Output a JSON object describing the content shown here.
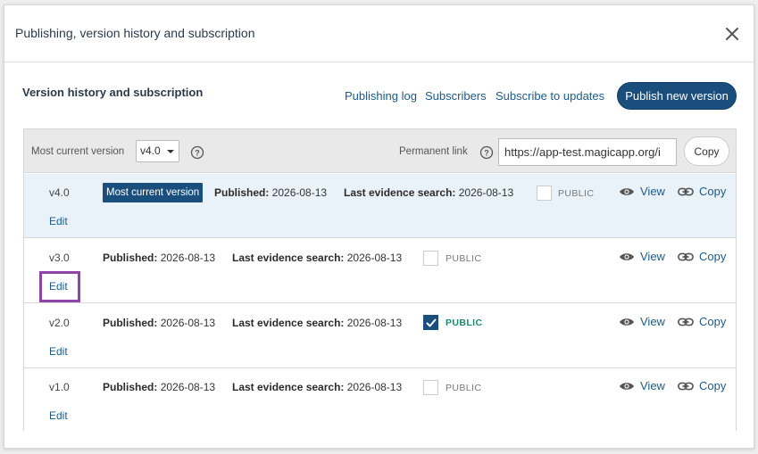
{
  "dialog": {
    "title": "Publishing, version history and subscription"
  },
  "section": {
    "title": "Version history and subscription",
    "links": {
      "publishing_log": "Publishing log",
      "subscribers": "Subscribers",
      "subscribe": "Subscribe to updates"
    },
    "publish_button": "Publish new version"
  },
  "toolbar": {
    "current_version_label": "Most current version",
    "selected_version": "v4.0",
    "permanent_link_label": "Permanent link",
    "permanent_link_value": "https://app-test.magicapp.org/i",
    "copy_label": "Copy"
  },
  "labels": {
    "published": "Published:",
    "last_search": "Last evidence search:",
    "public": "PUBLIC",
    "view": "View",
    "copy": "Copy",
    "edit": "Edit",
    "most_current": "Most current version"
  },
  "versions": [
    {
      "version": "v4.0",
      "published": "2026-08-13",
      "last_search": "2026-08-13",
      "public": false,
      "current": true
    },
    {
      "version": "v3.0",
      "published": "2026-08-13",
      "last_search": "2026-08-13",
      "public": false,
      "current": false
    },
    {
      "version": "v2.0",
      "published": "2026-08-13",
      "last_search": "2026-08-13",
      "public": true,
      "current": false
    },
    {
      "version": "v1.0",
      "published": "2026-08-13",
      "last_search": "2026-08-13",
      "public": false,
      "current": false
    }
  ],
  "colors": {
    "primary": "#1a4f7d",
    "link": "#1d5a8c",
    "public_on": "#1a8a6d",
    "highlight_outline": "#8e44a8"
  }
}
